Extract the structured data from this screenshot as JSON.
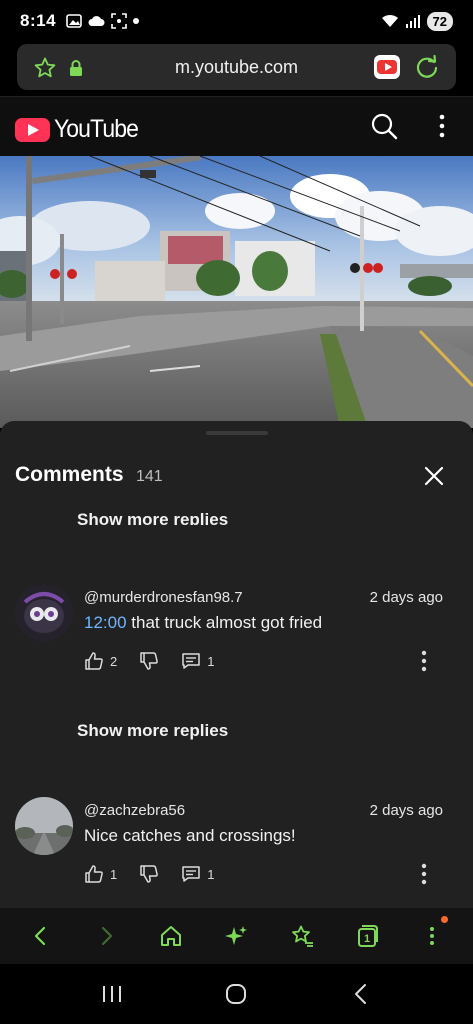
{
  "status_bar": {
    "time": "8:14",
    "battery": "72"
  },
  "browser": {
    "url": "m.youtube.com"
  },
  "youtube": {
    "logo_text": "YouTube"
  },
  "comments_panel": {
    "title": "Comments",
    "count": "141",
    "top_clipped_show_more": "Show more replies",
    "comments": [
      {
        "author": "@murderdronesfan98.7",
        "time": "2 days ago",
        "timestamp": "12:00",
        "text": " that truck almost got fried",
        "likes": "2",
        "replies": "1"
      },
      {
        "author": "@zachzebra56",
        "time": "2 days ago",
        "text": "Nice catches and crossings!",
        "likes": "1",
        "replies": "1"
      }
    ],
    "show_more_replies": "Show more replies"
  },
  "colors": {
    "accent_green": "#7ed957",
    "youtube_red": "#ff3355",
    "timestamp_link": "#6fb6ff",
    "sheet_bg": "#212121"
  },
  "icons": {
    "toolbar": [
      "back-icon",
      "forward-icon",
      "home-icon",
      "sparkle-icon",
      "bookmarks-icon",
      "tabs-icon",
      "more-icon"
    ],
    "tabs_count": "1"
  }
}
